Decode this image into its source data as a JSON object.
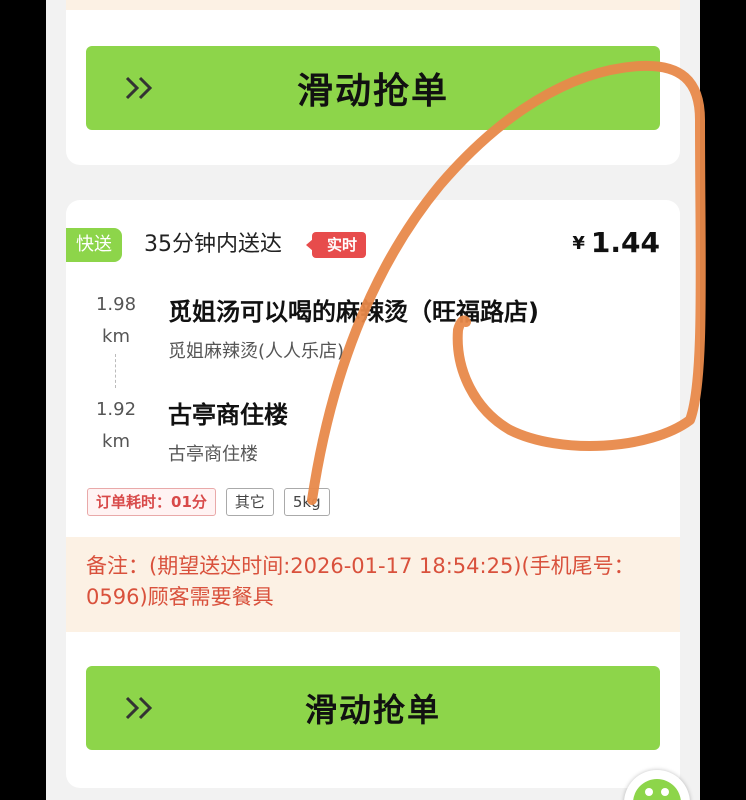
{
  "top_card": {
    "grab_label": "滑动抢单"
  },
  "order": {
    "fast_tag": "快送",
    "eta_text": "35分钟内送达",
    "realtime_tag": "实时",
    "currency": "¥",
    "price": "1.44",
    "pickup": {
      "distance_value": "1.98",
      "distance_unit": "km",
      "name": "觅姐汤可以喝的麻辣烫（旺福路店)",
      "subtitle": "觅姐麻辣烫(人人乐店)"
    },
    "dropoff": {
      "distance_value": "1.92",
      "distance_unit": "km",
      "name": "古亭商住楼",
      "subtitle": "古亭商住楼"
    },
    "badges": {
      "time_consumed": "订单耗时：01分",
      "category": "其它",
      "weight": "5kg"
    },
    "remark": "备注：(期望送达时间:2026-01-17 18:54:25)(手机尾号：0596)顾客需要餐具",
    "grab_label": "滑动抢单"
  },
  "icons": {
    "chevron": "double-chevron-right-icon",
    "float": "chat-assistant-icon"
  },
  "colors": {
    "accent_green": "#8dd54a",
    "realtime_red": "#e74c4c",
    "remark_bg": "#fcf1e4",
    "remark_text": "#d9513c",
    "annotation_orange": "#e8894a"
  }
}
